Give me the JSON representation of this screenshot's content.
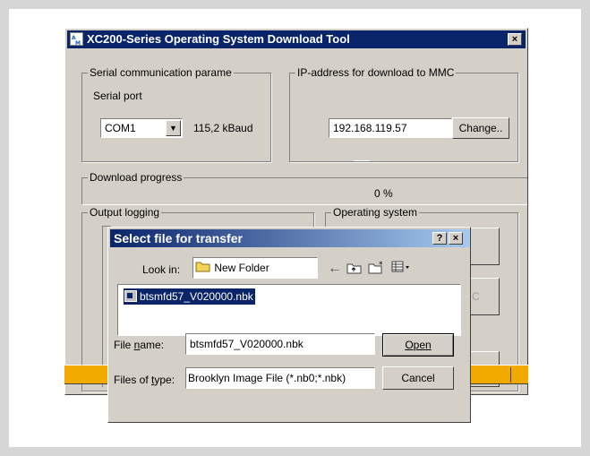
{
  "main_window": {
    "title": "XC200-Series Operating System Download Tool",
    "serial_group": {
      "label": "Serial communication parame",
      "port_label": "Serial port",
      "port_value": "COM1",
      "baud": "115,2 kBaud"
    },
    "ip_group": {
      "label": "IP-address for download to MMC",
      "ip_value": "192.168.119.57",
      "change_button": "Change.."
    },
    "progress_group": {
      "label": "Download progress",
      "percent": "0 %",
      "progress_fraction": 0
    },
    "output_group": {
      "label": "Output logging"
    },
    "os_group": {
      "label": "Operating system",
      "mmc_button_partial": "MC"
    }
  },
  "file_dialog": {
    "title": "Select file for transfer",
    "help_glyph": "?",
    "close_glyph": "×",
    "look_in_label": "Look in:",
    "look_in_value": "New Folder",
    "file_item": "btsmfd57_V020000.nbk",
    "file_name_label": "File name:",
    "file_name_value": "btsmfd57_V020000.nbk",
    "files_of_type_label": "Files of type:",
    "files_of_type_value": "Brooklyn Image File (*.nb0;*.nbk)",
    "open_button": "Open",
    "cancel_button": "Cancel"
  },
  "colors": {
    "title_active": "#0a246a",
    "face": "#d4d0c8",
    "statusbar": "#f2a900",
    "selection": "#0a246a"
  },
  "icons": [
    "app-icon",
    "folder-icon",
    "back-arrow-icon",
    "up-folder-icon",
    "new-folder-icon",
    "view-menu-icon",
    "file-icon"
  ]
}
